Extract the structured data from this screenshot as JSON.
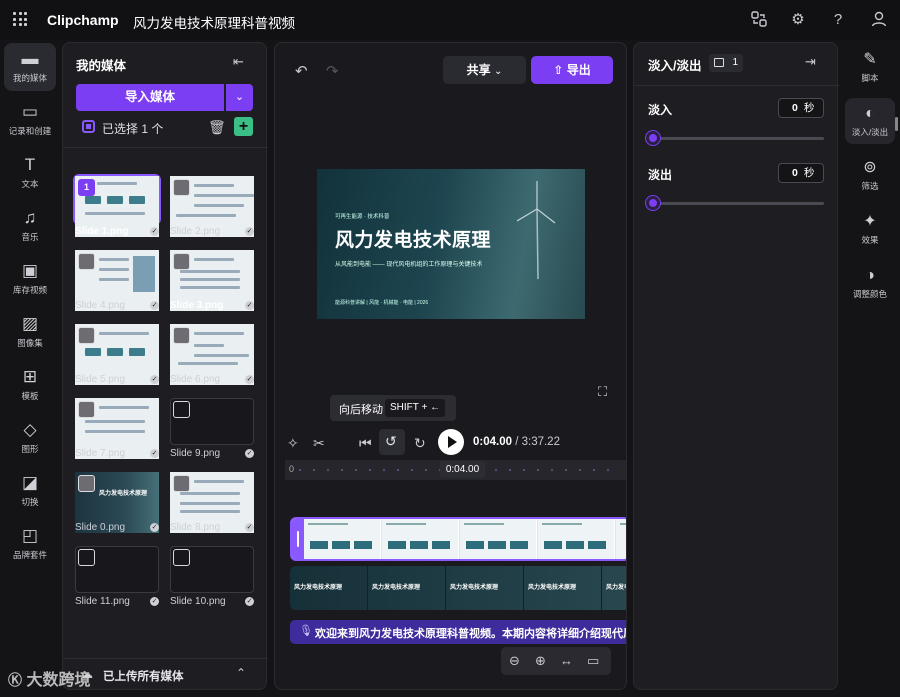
{
  "app": {
    "brand": "Clipchamp",
    "project_title": "风力发电技术原理科普视频"
  },
  "left_rail": [
    {
      "label": "我的媒体",
      "icon": "folder-icon"
    },
    {
      "label": "记录和创建",
      "icon": "camera-icon"
    },
    {
      "label": "文本",
      "icon": "text-icon"
    },
    {
      "label": "音乐",
      "icon": "music-icon"
    },
    {
      "label": "库存视频",
      "icon": "film-icon"
    },
    {
      "label": "图像集",
      "icon": "image-icon"
    },
    {
      "label": "模板",
      "icon": "template-icon"
    },
    {
      "label": "图形",
      "icon": "shapes-icon"
    },
    {
      "label": "切换",
      "icon": "transition-icon"
    },
    {
      "label": "品牌套件",
      "icon": "brand-kit-icon"
    }
  ],
  "media": {
    "title": "我的媒体",
    "import_label": "导入媒体",
    "selected_text": "已选择 1 个",
    "footer_label": "已上传所有媒体",
    "selected_badge": "1",
    "items": [
      {
        "name": "Slide 1.png"
      },
      {
        "name": "Slide 2.png"
      },
      {
        "name": "Slide 4.png"
      },
      {
        "name": "Slide 3.png"
      },
      {
        "name": "Slide 5.png"
      },
      {
        "name": "Slide 6.png"
      },
      {
        "name": "Slide 7.png"
      },
      {
        "name": "Slide 9.png"
      },
      {
        "name": "Slide 0.png"
      },
      {
        "name": "Slide 8.png"
      },
      {
        "name": "Slide 11.png"
      },
      {
        "name": "Slide 10.png"
      }
    ],
    "slide0_thumb_title": "风力发电技术原理"
  },
  "toolbar": {
    "share_label": "共享",
    "export_label": "导出"
  },
  "preview": {
    "tag": "可再生能源 · 技术科普",
    "title": "风力发电技术原理",
    "subtitle": "从风能到电能 —— 现代风电机组的工作原理与关键技术",
    "footer": "能源科普讲解 | 风能 · 机械能 · 电能 | 2026"
  },
  "tooltip": {
    "label": "向后移动",
    "shortcut": "SHIFT + ←"
  },
  "timeline": {
    "current": "0:04.00",
    "total": "/ 3:37.22",
    "ruler_start": "0",
    "ruler_now": "0:04.00",
    "slide_track_label": "风力发电技术原理",
    "audio_caption": "欢迎来到风力发电技术原理科普视频。本期内容将详细介绍现代风电"
  },
  "props": {
    "title": "淡入/淡出",
    "count": "1",
    "fade_in": {
      "label": "淡入",
      "value": "0",
      "unit": "秒"
    },
    "fade_out": {
      "label": "淡出",
      "value": "0",
      "unit": "秒"
    }
  },
  "right_rail": [
    {
      "label": "脚本",
      "icon": "script-icon"
    },
    {
      "label": "淡入/淡出",
      "icon": "fade-icon"
    },
    {
      "label": "筛选",
      "icon": "filter-icon"
    },
    {
      "label": "效果",
      "icon": "effects-icon"
    },
    {
      "label": "调整颜色",
      "icon": "color-adjust-icon"
    }
  ],
  "watermark": "大数跨境",
  "colors": {
    "accent": "#7b3ef2",
    "add_button": "#3bbf86"
  }
}
